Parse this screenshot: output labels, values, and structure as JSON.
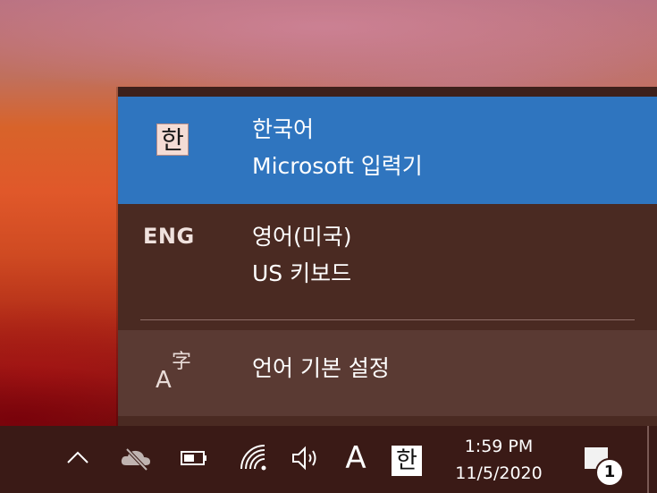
{
  "input_flyout": {
    "languages": [
      {
        "indicator": "한",
        "indicator_style": "boxed",
        "name": "한국어",
        "method": "Microsoft 입력기",
        "selected": true
      },
      {
        "indicator": "ENG",
        "indicator_style": "text",
        "name": "영어(미국)",
        "method": "US 키보드",
        "selected": false
      }
    ],
    "preferences": {
      "icon": "language-preferences-icon",
      "icon_text_a": "A",
      "icon_text_zi": "字",
      "label": "언어 기본 설정"
    }
  },
  "taskbar": {
    "tray_icons": [
      "chevron-up-icon",
      "onedrive-offline-icon",
      "battery-icon",
      "wifi-icon",
      "volume-icon"
    ],
    "ime_mode": "A",
    "ime_language": "한",
    "time": "1:59 PM",
    "date": "11/5/2020",
    "notification_count": "1"
  },
  "colors": {
    "selected_item": "#2f75bf",
    "flyout_bg": "#4a2a22",
    "taskbar_bg": "#3a1a16"
  }
}
